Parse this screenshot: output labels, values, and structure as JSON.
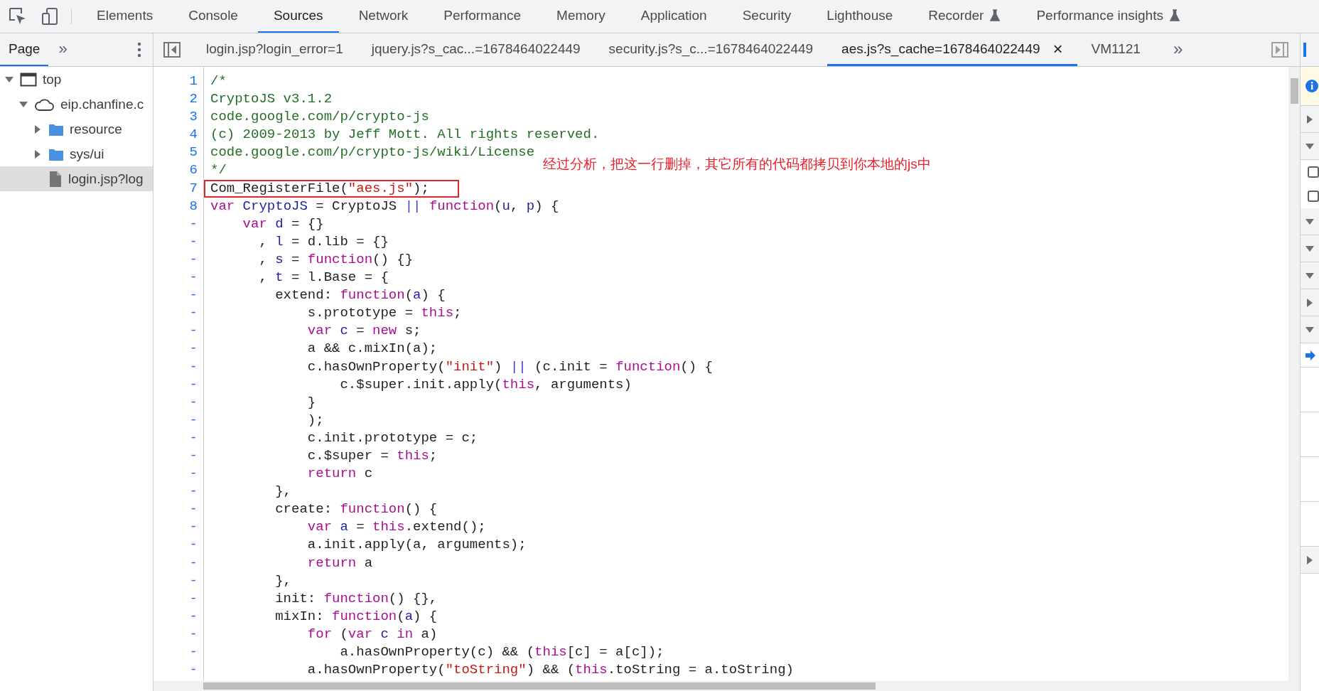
{
  "main_tabs": [
    {
      "label": "Elements",
      "selected": false,
      "experimental": false
    },
    {
      "label": "Console",
      "selected": false,
      "experimental": false
    },
    {
      "label": "Sources",
      "selected": true,
      "experimental": false
    },
    {
      "label": "Network",
      "selected": false,
      "experimental": false
    },
    {
      "label": "Performance",
      "selected": false,
      "experimental": false
    },
    {
      "label": "Memory",
      "selected": false,
      "experimental": false
    },
    {
      "label": "Application",
      "selected": false,
      "experimental": false
    },
    {
      "label": "Security",
      "selected": false,
      "experimental": false
    },
    {
      "label": "Lighthouse",
      "selected": false,
      "experimental": false
    },
    {
      "label": "Recorder",
      "selected": false,
      "experimental": true
    },
    {
      "label": "Performance insights",
      "selected": false,
      "experimental": true
    }
  ],
  "navigator": {
    "tabs": [
      {
        "label": "Page",
        "selected": true
      }
    ],
    "more": "»",
    "tree": [
      {
        "label": "top",
        "kind": "frame",
        "expanded": true,
        "selected": false,
        "children": [
          {
            "label": "eip.chanfine.c",
            "kind": "domain",
            "expanded": true,
            "selected": false,
            "children": [
              {
                "label": "resource",
                "kind": "folder",
                "expanded": false,
                "selected": false
              },
              {
                "label": "sys/ui",
                "kind": "folder",
                "expanded": false,
                "selected": false
              },
              {
                "label": "login.jsp?log",
                "kind": "file",
                "selected": true
              }
            ]
          }
        ]
      }
    ]
  },
  "file_tabs": [
    {
      "label": "login.jsp?login_error=1",
      "selected": false
    },
    {
      "label": "jquery.js?s_cac...=1678464022449",
      "selected": false
    },
    {
      "label": "security.js?s_c...=1678464022449",
      "selected": false
    },
    {
      "label": "aes.js?s_cache=1678464022449",
      "selected": true,
      "close": "×"
    },
    {
      "label": "VM1121",
      "selected": false
    }
  ],
  "file_tabs_more": "»",
  "editor": {
    "annotation": "经过分析，把这一行删掉，其它所有的代码都拷贝到你本地的js中",
    "lines": [
      {
        "number": "1",
        "boxed": false,
        "tokens": [
          {
            "kind": "comment",
            "text": "/*"
          }
        ]
      },
      {
        "number": "2",
        "boxed": false,
        "tokens": [
          {
            "kind": "comment",
            "text": "CryptoJS v3.1.2"
          }
        ]
      },
      {
        "number": "3",
        "boxed": false,
        "tokens": [
          {
            "kind": "comment",
            "text": "code.google.com/p/crypto-js"
          }
        ]
      },
      {
        "number": "4",
        "boxed": false,
        "tokens": [
          {
            "kind": "comment",
            "text": "(c) 2009-2013 by Jeff Mott. All rights reserved."
          }
        ]
      },
      {
        "number": "5",
        "boxed": false,
        "tokens": [
          {
            "kind": "comment",
            "text": "code.google.com/p/crypto-js/wiki/License"
          }
        ]
      },
      {
        "number": "6",
        "boxed": false,
        "tokens": [
          {
            "kind": "comment",
            "text": "*/"
          }
        ]
      },
      {
        "number": "7",
        "boxed": true,
        "tokens": [
          {
            "kind": "plain",
            "text": "Com_RegisterFile("
          },
          {
            "kind": "string",
            "text": "\"aes.js\""
          },
          {
            "kind": "plain",
            "text": ");"
          }
        ]
      },
      {
        "number": "8",
        "boxed": false,
        "tokens": [
          {
            "kind": "keyword",
            "text": "var"
          },
          {
            "kind": "def",
            "text": " CryptoJS"
          },
          {
            "kind": "plain",
            "text": " = CryptoJS "
          },
          {
            "kind": "operator",
            "text": "||"
          },
          {
            "kind": "keyword",
            "text": " function"
          },
          {
            "kind": "plain",
            "text": "("
          },
          {
            "kind": "def",
            "text": "u"
          },
          {
            "kind": "plain",
            "text": ", "
          },
          {
            "kind": "def",
            "text": "p"
          },
          {
            "kind": "plain",
            "text": ") {"
          }
        ]
      },
      {
        "number": "-",
        "boxed": false,
        "tokens": [
          {
            "kind": "keyword",
            "text": "    var"
          },
          {
            "kind": "def",
            "text": " d"
          },
          {
            "kind": "plain",
            "text": " = {}"
          }
        ]
      },
      {
        "number": "-",
        "boxed": false,
        "tokens": [
          {
            "kind": "plain",
            "text": "      , "
          },
          {
            "kind": "def",
            "text": "l"
          },
          {
            "kind": "plain",
            "text": " = d.lib = {}"
          }
        ]
      },
      {
        "number": "-",
        "boxed": false,
        "tokens": [
          {
            "kind": "plain",
            "text": "      , "
          },
          {
            "kind": "def",
            "text": "s"
          },
          {
            "kind": "plain",
            "text": " = "
          },
          {
            "kind": "keyword",
            "text": "function"
          },
          {
            "kind": "plain",
            "text": "() {}"
          }
        ]
      },
      {
        "number": "-",
        "boxed": false,
        "tokens": [
          {
            "kind": "plain",
            "text": "      , "
          },
          {
            "kind": "def",
            "text": "t"
          },
          {
            "kind": "plain",
            "text": " = l.Base = {"
          }
        ]
      },
      {
        "number": "-",
        "boxed": false,
        "tokens": [
          {
            "kind": "plain",
            "text": "        extend: "
          },
          {
            "kind": "keyword",
            "text": "function"
          },
          {
            "kind": "plain",
            "text": "("
          },
          {
            "kind": "def",
            "text": "a"
          },
          {
            "kind": "plain",
            "text": ") {"
          }
        ]
      },
      {
        "number": "-",
        "boxed": false,
        "tokens": [
          {
            "kind": "plain",
            "text": "            s.prototype = "
          },
          {
            "kind": "keyword",
            "text": "this"
          },
          {
            "kind": "plain",
            "text": ";"
          }
        ]
      },
      {
        "number": "-",
        "boxed": false,
        "tokens": [
          {
            "kind": "keyword",
            "text": "            var"
          },
          {
            "kind": "def",
            "text": " c"
          },
          {
            "kind": "plain",
            "text": " = "
          },
          {
            "kind": "keyword",
            "text": "new"
          },
          {
            "kind": "plain",
            "text": " s;"
          }
        ]
      },
      {
        "number": "-",
        "boxed": false,
        "tokens": [
          {
            "kind": "plain",
            "text": "            a && c.mixIn(a);"
          }
        ]
      },
      {
        "number": "-",
        "boxed": false,
        "tokens": [
          {
            "kind": "plain",
            "text": "            c.hasOwnProperty("
          },
          {
            "kind": "string",
            "text": "\"init\""
          },
          {
            "kind": "plain",
            "text": ") "
          },
          {
            "kind": "operator",
            "text": "||"
          },
          {
            "kind": "plain",
            "text": " (c.init = "
          },
          {
            "kind": "keyword",
            "text": "function"
          },
          {
            "kind": "plain",
            "text": "() {"
          }
        ]
      },
      {
        "number": "-",
        "boxed": false,
        "tokens": [
          {
            "kind": "plain",
            "text": "                c.$super.init.apply("
          },
          {
            "kind": "keyword",
            "text": "this"
          },
          {
            "kind": "plain",
            "text": ", arguments)"
          }
        ]
      },
      {
        "number": "-",
        "boxed": false,
        "tokens": [
          {
            "kind": "plain",
            "text": "            }"
          }
        ]
      },
      {
        "number": "-",
        "boxed": false,
        "tokens": [
          {
            "kind": "plain",
            "text": "            );"
          }
        ]
      },
      {
        "number": "-",
        "boxed": false,
        "tokens": [
          {
            "kind": "plain",
            "text": "            c.init.prototype = c;"
          }
        ]
      },
      {
        "number": "-",
        "boxed": false,
        "tokens": [
          {
            "kind": "plain",
            "text": "            c.$super = "
          },
          {
            "kind": "keyword",
            "text": "this"
          },
          {
            "kind": "plain",
            "text": ";"
          }
        ]
      },
      {
        "number": "-",
        "boxed": false,
        "tokens": [
          {
            "kind": "keyword",
            "text": "            return"
          },
          {
            "kind": "plain",
            "text": " c"
          }
        ]
      },
      {
        "number": "-",
        "boxed": false,
        "tokens": [
          {
            "kind": "plain",
            "text": "        },"
          }
        ]
      },
      {
        "number": "-",
        "boxed": false,
        "tokens": [
          {
            "kind": "plain",
            "text": "        create: "
          },
          {
            "kind": "keyword",
            "text": "function"
          },
          {
            "kind": "plain",
            "text": "() {"
          }
        ]
      },
      {
        "number": "-",
        "boxed": false,
        "tokens": [
          {
            "kind": "keyword",
            "text": "            var"
          },
          {
            "kind": "def",
            "text": " a"
          },
          {
            "kind": "plain",
            "text": " = "
          },
          {
            "kind": "keyword",
            "text": "this"
          },
          {
            "kind": "plain",
            "text": ".extend();"
          }
        ]
      },
      {
        "number": "-",
        "boxed": false,
        "tokens": [
          {
            "kind": "plain",
            "text": "            a.init.apply(a, arguments);"
          }
        ]
      },
      {
        "number": "-",
        "boxed": false,
        "tokens": [
          {
            "kind": "keyword",
            "text": "            return"
          },
          {
            "kind": "plain",
            "text": " a"
          }
        ]
      },
      {
        "number": "-",
        "boxed": false,
        "tokens": [
          {
            "kind": "plain",
            "text": "        },"
          }
        ]
      },
      {
        "number": "-",
        "boxed": false,
        "tokens": [
          {
            "kind": "plain",
            "text": "        init: "
          },
          {
            "kind": "keyword",
            "text": "function"
          },
          {
            "kind": "plain",
            "text": "() {},"
          }
        ]
      },
      {
        "number": "-",
        "boxed": false,
        "tokens": [
          {
            "kind": "plain",
            "text": "        mixIn: "
          },
          {
            "kind": "keyword",
            "text": "function"
          },
          {
            "kind": "plain",
            "text": "("
          },
          {
            "kind": "def",
            "text": "a"
          },
          {
            "kind": "plain",
            "text": ") {"
          }
        ]
      },
      {
        "number": "-",
        "boxed": false,
        "tokens": [
          {
            "kind": "keyword",
            "text": "            for"
          },
          {
            "kind": "plain",
            "text": " ("
          },
          {
            "kind": "keyword",
            "text": "var"
          },
          {
            "kind": "def",
            "text": " c"
          },
          {
            "kind": "keyword",
            "text": " in"
          },
          {
            "kind": "plain",
            "text": " a)"
          }
        ]
      },
      {
        "number": "-",
        "boxed": false,
        "tokens": [
          {
            "kind": "plain",
            "text": "                a.hasOwnProperty(c) && ("
          },
          {
            "kind": "keyword",
            "text": "this"
          },
          {
            "kind": "plain",
            "text": "[c] = a[c]);"
          }
        ]
      },
      {
        "number": "-",
        "boxed": false,
        "tokens": [
          {
            "kind": "plain",
            "text": "            a.hasOwnProperty("
          },
          {
            "kind": "string",
            "text": "\"toString\""
          },
          {
            "kind": "plain",
            "text": ") && ("
          },
          {
            "kind": "keyword",
            "text": "this"
          },
          {
            "kind": "plain",
            "text": ".toString = a.toString)"
          }
        ]
      }
    ]
  },
  "side_panel": [
    {
      "kind": "info"
    },
    {
      "kind": "section",
      "expanded": false
    },
    {
      "kind": "section",
      "expanded": true
    },
    {
      "kind": "checkbox",
      "checked": false
    },
    {
      "kind": "checkbox",
      "checked": false
    },
    {
      "kind": "section",
      "expanded": true
    },
    {
      "kind": "section",
      "expanded": true
    },
    {
      "kind": "section",
      "expanded": true
    },
    {
      "kind": "section",
      "expanded": false
    },
    {
      "kind": "section",
      "expanded": true
    },
    {
      "kind": "pointer"
    },
    {
      "kind": "blank"
    },
    {
      "kind": "blank"
    },
    {
      "kind": "blank"
    },
    {
      "kind": "blank"
    },
    {
      "kind": "section",
      "expanded": false
    }
  ]
}
